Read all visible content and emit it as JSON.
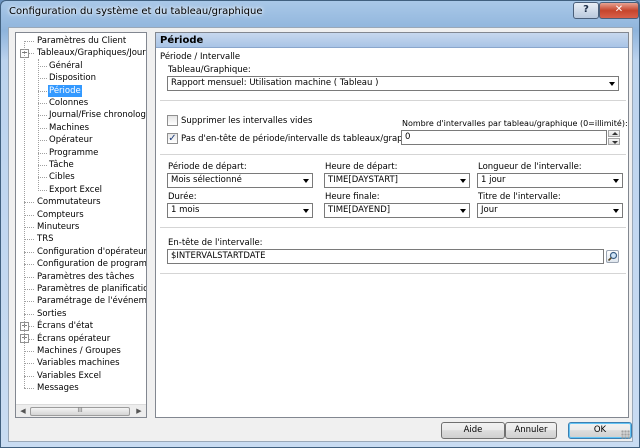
{
  "window": {
    "title": "Configuration du système et du tableau/graphique",
    "help_glyph": "?",
    "close_glyph": "✕"
  },
  "tree": {
    "items": [
      {
        "label": "Paramètres du Client",
        "level": 0
      },
      {
        "label": "Tableaux/Graphiques/Journal",
        "level": 0,
        "expander": "−"
      },
      {
        "label": "Général",
        "level": 1
      },
      {
        "label": "Disposition",
        "level": 1
      },
      {
        "label": "Période",
        "level": 1,
        "selected": true
      },
      {
        "label": "Colonnes",
        "level": 1
      },
      {
        "label": "Journal/Frise chronologique",
        "level": 1
      },
      {
        "label": "Machines",
        "level": 1
      },
      {
        "label": "Opérateur",
        "level": 1
      },
      {
        "label": "Programme",
        "level": 1
      },
      {
        "label": "Tâche",
        "level": 1
      },
      {
        "label": "Cibles",
        "level": 1
      },
      {
        "label": "Export Excel",
        "level": 1
      },
      {
        "label": "Commutateurs",
        "level": 0
      },
      {
        "label": "Compteurs",
        "level": 0
      },
      {
        "label": "Minuteurs",
        "level": 0
      },
      {
        "label": "TRS",
        "level": 0
      },
      {
        "label": "Configuration d'opérateur",
        "level": 0
      },
      {
        "label": "Configuration de programme",
        "level": 0
      },
      {
        "label": "Paramètres des tâches",
        "level": 0
      },
      {
        "label": "Paramètres de planification",
        "level": 0
      },
      {
        "label": "Paramétrage de l'événement",
        "level": 0
      },
      {
        "label": "Sorties",
        "level": 0
      },
      {
        "label": "Écrans d'état",
        "level": 0,
        "expander": "+"
      },
      {
        "label": "Écrans opérateur",
        "level": 0,
        "expander": "+"
      },
      {
        "label": "Machines / Groupes",
        "level": 0
      },
      {
        "label": "Variables machines",
        "level": 0
      },
      {
        "label": "Variables Excel",
        "level": 0
      },
      {
        "label": "Messages",
        "level": 0
      }
    ],
    "scroll_left": "◀",
    "scroll_right": "▶",
    "scroll_grip": "III"
  },
  "panel": {
    "header": "Période",
    "group_label": "Période / Intervalle",
    "tableau_label": "Tableau/Graphique:",
    "tableau_value": "Rapport mensuel: Utilisation machine  ( Tableau )",
    "suppress_label": "Supprimer les intervalles vides",
    "suppress_checked": false,
    "no_header_label": "Pas d'en-tête de période/intervalle ds tableaux/graphique",
    "no_header_checked": true,
    "check_glyph": "✓",
    "nb_intervals_label": "Nombre d'intervalles par tableau/graphique (0=illimité):",
    "nb_intervals_value": "0",
    "start_period_label": "Période de départ:",
    "start_period_value": "Mois sélectionné",
    "start_time_label": "Heure de départ:",
    "start_time_value": "TIME[DAYSTART]",
    "interval_length_label": "Longueur de l'intervalle:",
    "interval_length_value": "1 jour",
    "duration_label": "Durée:",
    "duration_value": "1 mois",
    "end_time_label": "Heure finale:",
    "end_time_value": "TIME[DAYEND]",
    "interval_title_label": "Titre de l'intervalle:",
    "interval_title_value": "Jour",
    "interval_header_label": "En-tête de l'intervalle:",
    "interval_header_value": "$INTERVALSTARTDATE"
  },
  "buttons": {
    "help": "Aide",
    "cancel": "Annuler",
    "ok": "OK"
  }
}
